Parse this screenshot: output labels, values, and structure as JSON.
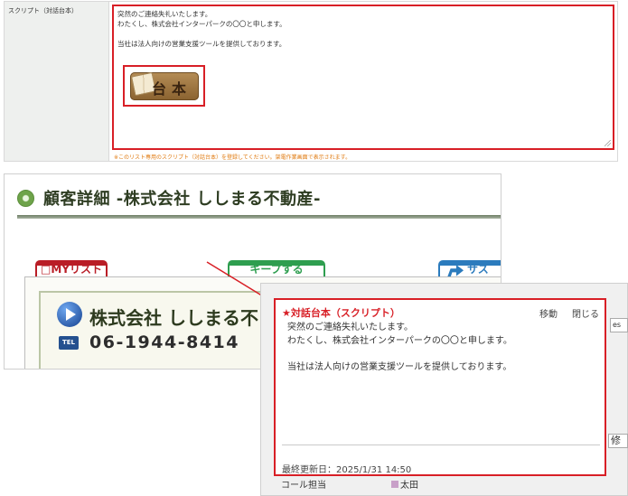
{
  "form": {
    "label": "スクリプト（対話台本）",
    "script_lines": [
      "突然のご連絡失礼いたします。",
      "わたくし、株式会社インターパークの〇〇と申します。",
      "",
      "当社は法人向けの営業支援ツールを提供しております。"
    ],
    "note": "※このリスト専用のスクリプト（対話台本）を登録してください。架電作業画面で表示されます。"
  },
  "detail": {
    "title": "顧客詳細 -株式会社 ししまる不動産-",
    "tabs": {
      "mylist": "□MYリスト",
      "daihon": "台本",
      "keep": "キープする",
      "sas": "サス"
    },
    "company_name": "株式会社 ししまる不",
    "tel_label": "TEL",
    "tel_number": "06-1944-8414"
  },
  "popup": {
    "title": "★対話台本（スクリプト）",
    "move_label": "移動",
    "close_label": "閉じる",
    "body_lines": [
      "突然のご連絡失礼いたします。",
      "わたくし、株式会社インターパークの〇〇と申します。",
      "",
      "当社は法人向けの営業支援ツールを提供しております。"
    ],
    "last_updated": "最終更新日：2025/1/31 14:50",
    "side_tab": "es",
    "side_field": "修",
    "bottom_label": "コール担当",
    "bottom_value": "太田"
  },
  "colors": {
    "highlight": "#d81f26",
    "note": "#e07a10",
    "title_green": "#2e3d22"
  }
}
